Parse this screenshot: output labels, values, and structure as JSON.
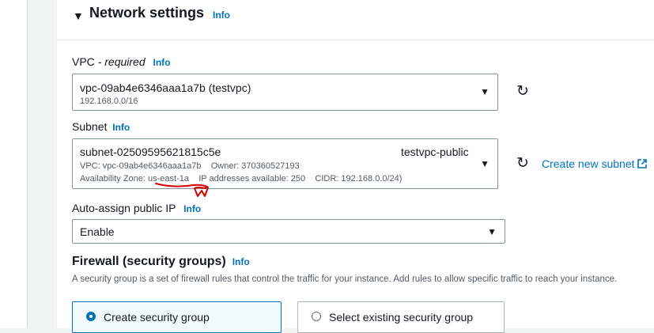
{
  "section": {
    "title": "Network settings",
    "info": "Info"
  },
  "vpc": {
    "label": "VPC",
    "required_suffix": "- required",
    "info": "Info",
    "selected": "vpc-09ab4e6346aaa1a7b (testvpc)",
    "cidr": "192.168.0.0/16"
  },
  "subnet": {
    "label": "Subnet",
    "info": "Info",
    "selected": "subnet-02509595621815c5e",
    "name": "testvpc-public",
    "detail_line1": "VPC: vpc-09ab4e6346aaa1a7b    Owner: 370360527193",
    "detail_line2": "Availability Zone: us-east-1a    IP addresses available: 250    CIDR: 192.168.0.0/24)",
    "create_link": "Create new subnet"
  },
  "auto_ip": {
    "label": "Auto-assign public IP",
    "info": "Info",
    "selected": "Enable"
  },
  "firewall": {
    "title": "Firewall (security groups)",
    "info": "Info",
    "description": "A security group is a set of firewall rules that control the traffic for your instance. Add rules to allow specific traffic to reach your instance.",
    "option_create": "Create security group",
    "option_existing": "Select existing security group"
  },
  "icons": {
    "collapse": "caret-down-icon",
    "refresh": "refresh-icon",
    "dropdown": "triangle-down-icon",
    "external": "external-link-icon",
    "annotation": "red-scribble-annotation"
  },
  "colors": {
    "link": "#0073bb",
    "annotation": "#d40000",
    "selected_tile_bg": "#f1faff"
  }
}
